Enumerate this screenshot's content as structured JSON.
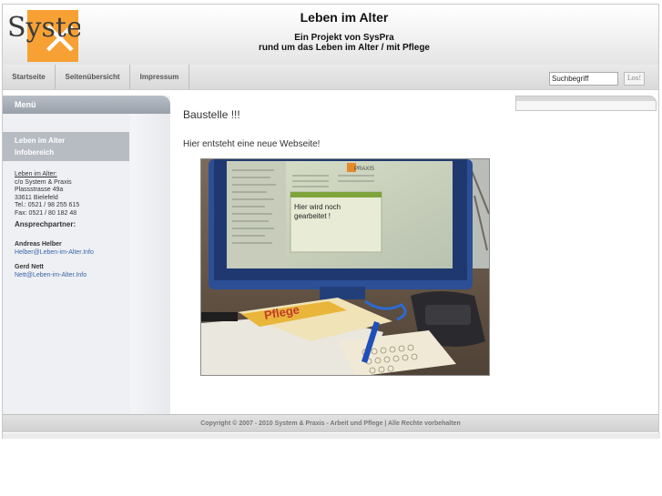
{
  "header": {
    "logo_text": "Syste",
    "title": "Leben im Alter",
    "subtitle1": "Ein Projekt von SysPra",
    "subtitle2": "rund um das Leben im Alter / mit Pflege"
  },
  "nav": {
    "items": [
      {
        "label": "Startseite"
      },
      {
        "label": "Seitenübersicht"
      },
      {
        "label": "Impressum"
      }
    ]
  },
  "search": {
    "value": "Suchbegriff",
    "button_label": "Los!"
  },
  "sidebar": {
    "menu_label": "Menü",
    "active_item_line1": "Leben im Alter",
    "active_item_line2": "Infobereich",
    "address": {
      "name": "Leben im Alter:",
      "co": "c/o System & Praxis",
      "street": "Plassstrasse 49a",
      "city": "33611 Bielefeld",
      "tel": "Tel.: 0521 / 98 255 615",
      "fax": "Fax: 0521 / 80 182 48"
    },
    "contact_heading": "Ansprechpartner:",
    "contacts": [
      {
        "name": "Andreas Helber",
        "email": "Helber@Leben-im-Alter.Info"
      },
      {
        "name": "Gerd Nett",
        "email": "Nett@Leben-im-Alter.Info"
      }
    ]
  },
  "main": {
    "title": "Baustelle !!!",
    "text": "Hier entsteht eine neue Webseite!",
    "photo": {
      "screen_text1": "Hier wird noch",
      "screen_text2": "gearbeitet !",
      "magazine_text": "Pflege",
      "brand_text": "PRAXIS"
    }
  },
  "footer": {
    "text": "Copyright © 2007 - 2010 System & Praxis - Arbeit und Pflege | Alle Rechte vorbehalten"
  },
  "colors": {
    "logo_orange": "#f7a134",
    "link_blue": "#3a64a8",
    "menu_gray": "#98a0aa"
  }
}
